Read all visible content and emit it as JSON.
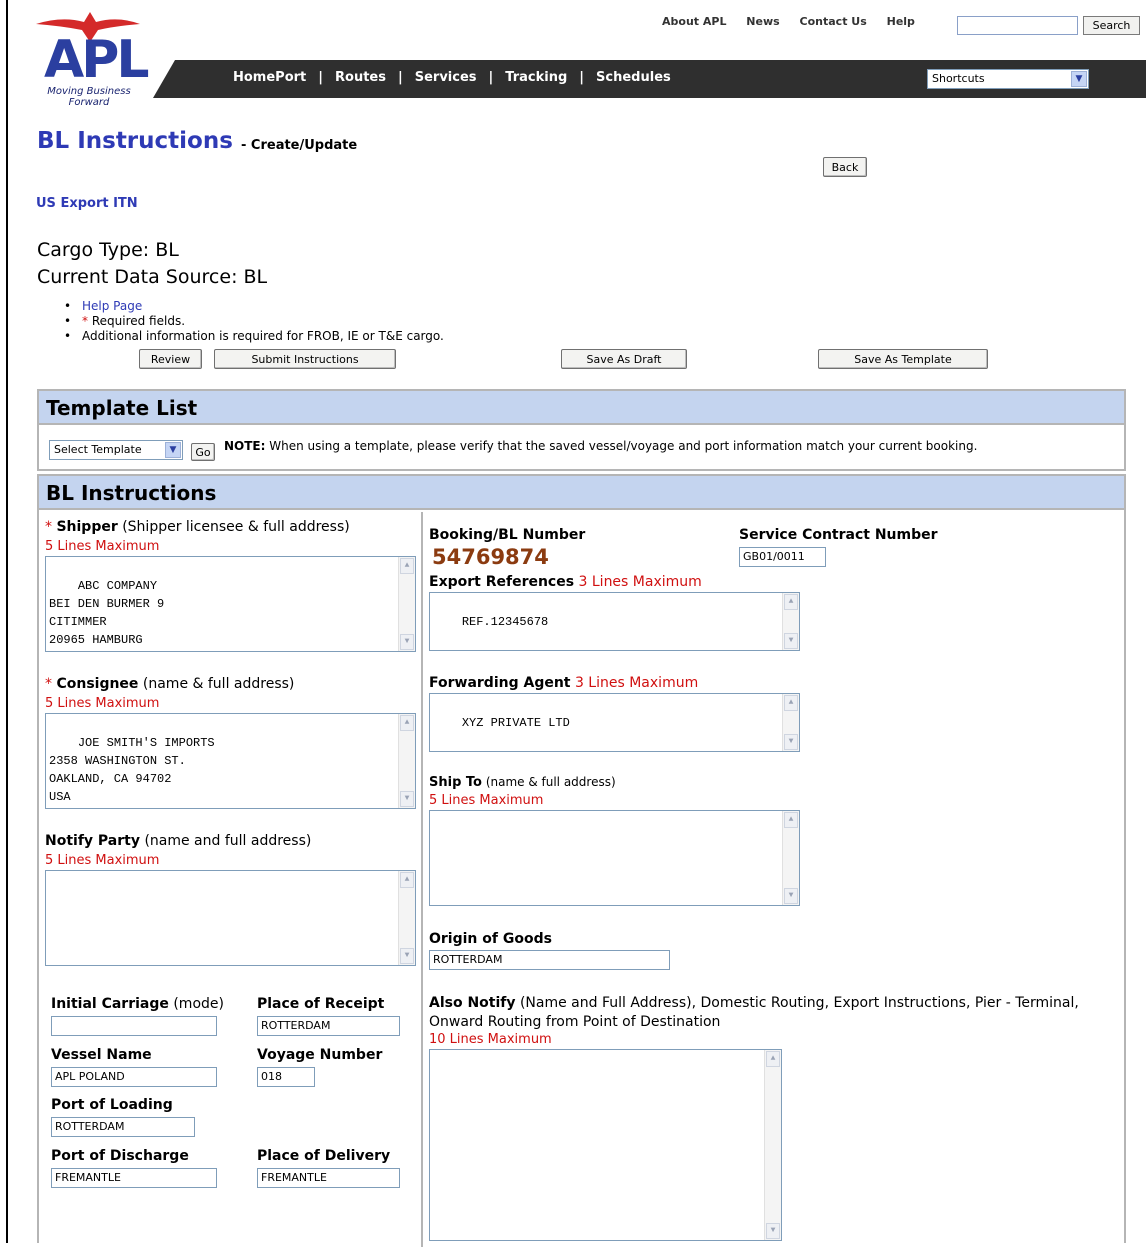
{
  "header": {
    "logo_text": "APL",
    "logo_tagline": "Moving Business Forward",
    "top_links": [
      "About APL",
      "News",
      "Contact Us",
      "Help"
    ],
    "search_value": "",
    "search_button": "Search",
    "nav": [
      "HomePort",
      "Routes",
      "Services",
      "Tracking",
      "Schedules"
    ],
    "nav_separator": "|",
    "shortcuts_selected": "Shortcuts"
  },
  "page": {
    "title": "BL Instructions",
    "subtitle": "- Create/Update",
    "back_button": "Back",
    "us_export_link": "US Export ITN",
    "cargo_type": "Cargo Type: BL",
    "data_source": "Current Data Source: BL",
    "bullets": {
      "help": "Help Page",
      "required_star": "*",
      "required": "Required fields.",
      "additional": "Additional information is required for FROB, IE or T&E cargo."
    },
    "actions": {
      "review": "Review",
      "submit": "Submit Instructions",
      "draft": "Save As Draft",
      "template": "Save As Template"
    }
  },
  "template_list": {
    "heading": "Template List",
    "select_value": "Select Template",
    "go_button": "Go",
    "note_label": "NOTE:",
    "note_text": "When using a template, please verify that the saved vessel/voyage and port information match your current booking."
  },
  "bl": {
    "heading": "BL Instructions",
    "required_star": "*",
    "shipper": {
      "label": "Shipper",
      "hint": "(Shipper licensee & full address)",
      "max": "5 Lines Maximum",
      "value": "ABC COMPANY\nBEI DEN BURMER 9\nCITIMMER\n20965 HAMBURG"
    },
    "consignee": {
      "label": "Consignee",
      "hint": "(name & full address)",
      "max": "5 Lines Maximum",
      "value": "JOE SMITH'S IMPORTS\n2358 WASHINGTON ST.\nOAKLAND, CA 94702\nUSA"
    },
    "notify": {
      "label": "Notify Party",
      "hint": "(name and full address)",
      "max": "5 Lines Maximum",
      "value": ""
    },
    "initial_carriage": {
      "label": "Initial Carriage",
      "hint": "(mode)",
      "value": ""
    },
    "place_of_receipt": {
      "label": "Place of Receipt",
      "value": "ROTTERDAM"
    },
    "vessel_name": {
      "label": "Vessel Name",
      "value": "APL POLAND"
    },
    "voyage_number": {
      "label": "Voyage Number",
      "value": "018"
    },
    "port_of_loading": {
      "label": "Port of Loading",
      "value": "ROTTERDAM"
    },
    "port_of_discharge": {
      "label": "Port of Discharge",
      "value": "FREMANTLE"
    },
    "place_of_delivery": {
      "label": "Place of Delivery",
      "value": "FREMANTLE"
    },
    "booking": {
      "label": "Booking/BL Number",
      "value": "54769874"
    },
    "service_contract": {
      "label": "Service Contract Number",
      "value": "GB01/0011"
    },
    "export_refs": {
      "label": "Export References",
      "max": "3 Lines Maximum",
      "value": "REF.12345678"
    },
    "forwarding_agent": {
      "label": "Forwarding Agent",
      "max": "3 Lines Maximum",
      "value": "XYZ PRIVATE LTD"
    },
    "ship_to": {
      "label": "Ship To",
      "hint": "(name & full address)",
      "max": "5 Lines Maximum",
      "value": ""
    },
    "origin": {
      "label": "Origin of Goods",
      "value": "ROTTERDAM"
    },
    "also_notify": {
      "label": "Also Notify",
      "hint": "(Name and Full Address), Domestic Routing, Export Instructions, Pier - Terminal, Onward Routing from Point of Destination",
      "max": "10 Lines Maximum",
      "value": ""
    }
  },
  "colors": {
    "title_blue": "#2e3ab5",
    "nav_bg": "#2f2f2f",
    "panel_head": "#c4d4ef",
    "required_red": "#d01010",
    "booking_brown": "#8b3b10"
  }
}
